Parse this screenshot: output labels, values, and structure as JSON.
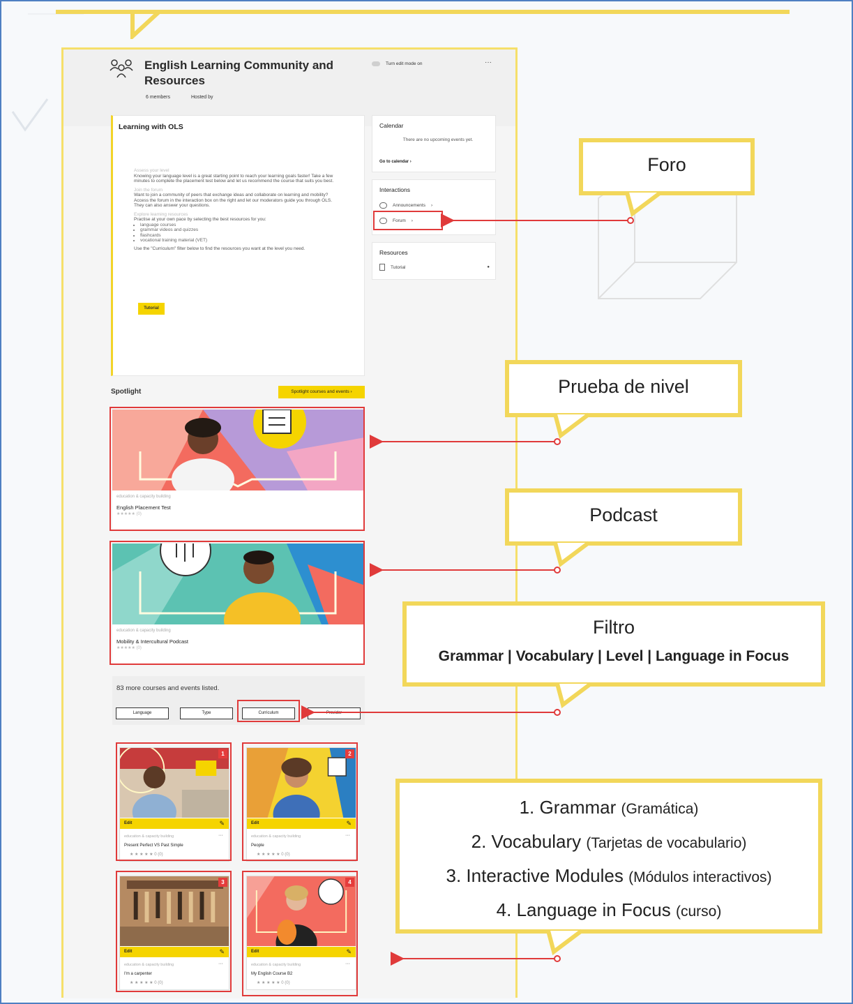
{
  "colors": {
    "accent_yellow": "#f5d400",
    "callout_border": "#f2d75a",
    "highlight_red": "#e03a3a",
    "frame_blue": "#4f7fc2"
  },
  "community": {
    "icon": "people-group-icon",
    "title": "English Learning Community and Resources",
    "members": "6 members",
    "hosted_by": "Hosted by",
    "edit_mode": "Turn edit mode on",
    "more": "···"
  },
  "learning": {
    "title": "Learning with OLS",
    "sections": [
      {
        "heading": "Assess your level",
        "text": "Knowing your language level is a great starting point to reach your learning goals faster! Take a few minutes to complete the placement test below and let us recommend the course that suits you best."
      },
      {
        "heading": "Join the forum",
        "text": "Want to join a community of peers that exchange ideas and collaborate on learning and mobility? Access the forum in the interaction box on the right and let our moderators guide you through OLS. They can also answer your questions."
      },
      {
        "heading": "Explore learning resources",
        "text": "Practise at your own pace by selecting the best resources for you:"
      }
    ],
    "list": [
      "language courses",
      "grammar videos and quizzes",
      "flashcards",
      "vocational training material (VET)"
    ],
    "footer": "Use the \"Curriculum\" filter below to find the resources you want at the level you need.",
    "button": "Tutorial"
  },
  "calendar": {
    "title": "Calendar",
    "empty": "There are no upcoming events yet.",
    "link": "Go to calendar"
  },
  "interactions": {
    "title": "Interactions",
    "items": [
      "Announcements",
      "Forum"
    ]
  },
  "resources": {
    "title": "Resources",
    "items": [
      "Tutorial"
    ]
  },
  "spotlight": {
    "label": "Spotlight",
    "button": "Spotlight courses and events",
    "cards": [
      {
        "category": "education & capacity building",
        "name": "English Placement Test",
        "stars": "★★★★★ (0)"
      },
      {
        "category": "education & capacity building",
        "name": "Mobility & Intercultural Podcast",
        "stars": "★★★★★ (0)"
      }
    ]
  },
  "more_courses": {
    "text": "83 more courses and events listed.",
    "filters": [
      "Language",
      "Type",
      "Curriculum",
      "Provider"
    ]
  },
  "courses": [
    {
      "number": "1",
      "edit": "Edit",
      "category": "education & capacity building",
      "name": "Present Perfect VS Past Simple",
      "rating": "★ ★ ★ ★ ★  0 (0)"
    },
    {
      "number": "2",
      "edit": "Edit",
      "category": "education & capacity building",
      "name": "People",
      "rating": "★ ★ ★ ★ ★  0 (0)"
    },
    {
      "number": "3",
      "edit": "Edit",
      "category": "education & capacity building",
      "name": "I'm a carpenter",
      "rating": "★ ★ ★ ★ ★  0 (0)"
    },
    {
      "number": "4",
      "edit": "Edit",
      "category": "education & capacity building",
      "name": "My English Course B2",
      "rating": "★ ★ ★ ★ ★  0 (0)"
    }
  ],
  "callouts": {
    "foro": "Foro",
    "prueba": "Prueba de nivel",
    "podcast": "Podcast",
    "filtro_title": "Filtro",
    "filtro_sub": "Grammar | Vocabulary | Level | Language in Focus",
    "list": [
      {
        "num": "1.",
        "name": "Grammar",
        "paren": "(Gramática)"
      },
      {
        "num": "2.",
        "name": "Vocabulary",
        "paren": "(Tarjetas de vocabulario)"
      },
      {
        "num": "3.",
        "name": "Interactive Modules",
        "paren": "(Módulos interactivos)"
      },
      {
        "num": "4.",
        "name": "Language in Focus",
        "paren": "(curso)"
      }
    ]
  }
}
